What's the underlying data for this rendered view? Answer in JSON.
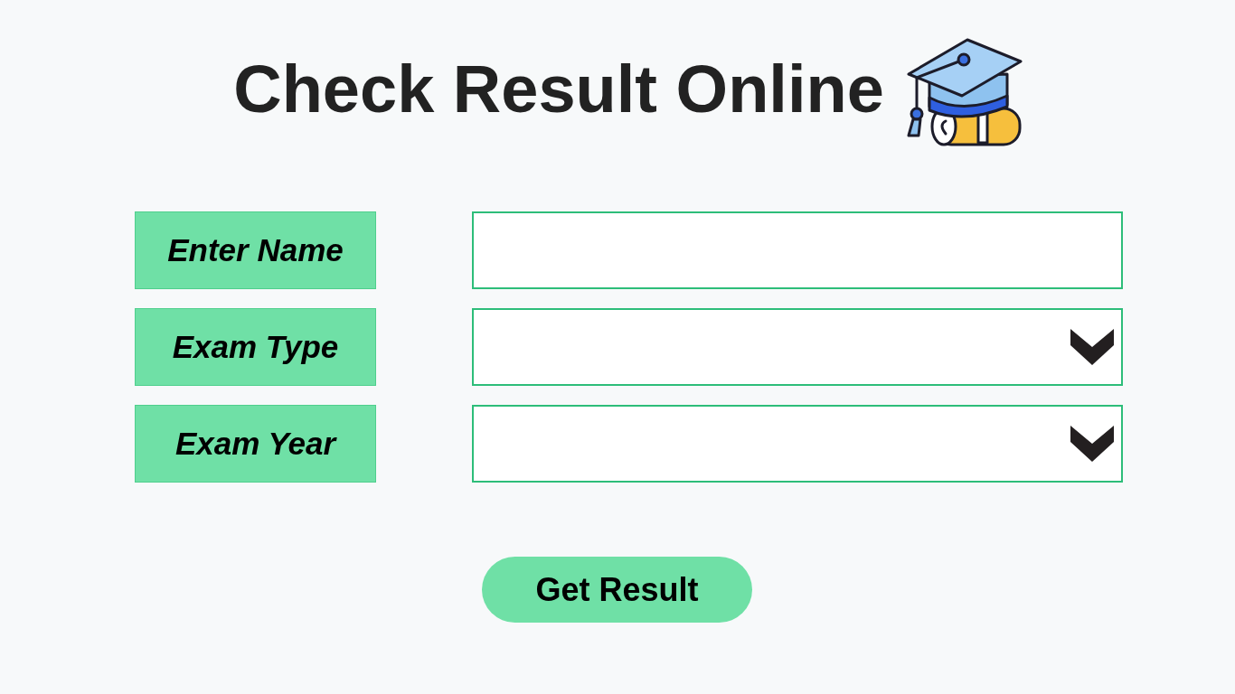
{
  "title": "Check Result Online",
  "form": {
    "fields": [
      {
        "label": "Enter Name",
        "kind": "text"
      },
      {
        "label": "Exam Type",
        "kind": "select"
      },
      {
        "label": "Exam Year",
        "kind": "select"
      }
    ]
  },
  "submit_button": {
    "label": "Get Result"
  }
}
